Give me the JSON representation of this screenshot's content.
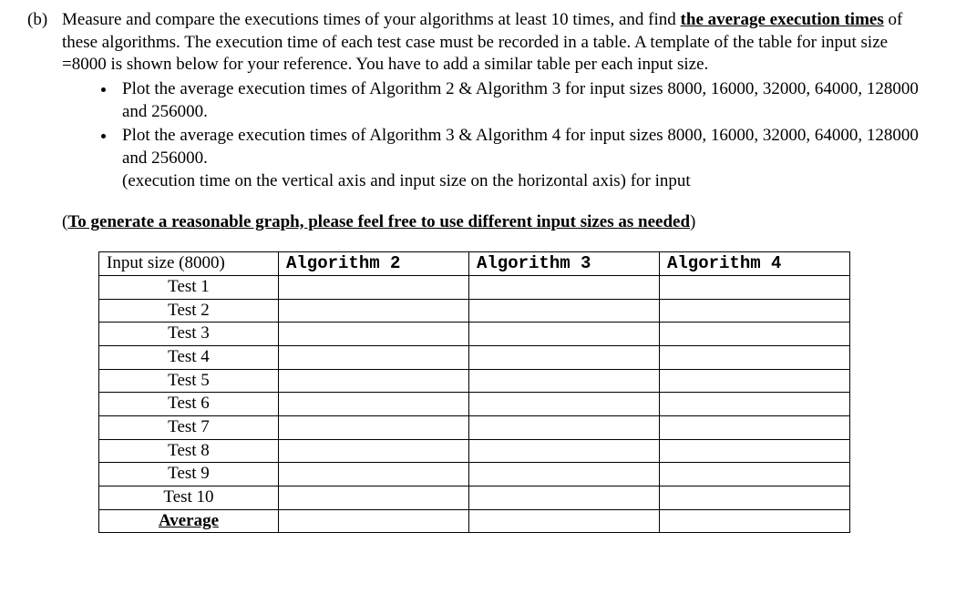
{
  "question": {
    "label": "(b)",
    "intro_1": "Measure and compare the executions times of your algorithms at least 10 times, and find ",
    "intro_underlined": "the average execution times",
    "intro_2": " of these algorithms. The execution time of each test case must be recorded in a table. A template of the table for input size =8000 is shown below for your reference. You have to add a similar table per each input size.",
    "bullets": [
      "Plot the average execution times of Algorithm 2 & Algorithm 3 for input sizes 8000, 16000, 32000, 64000, 128000 and 256000.",
      "Plot the average execution times of Algorithm 3 & Algorithm 4 for input sizes 8000, 16000, 32000, 64000, 128000 and 256000.\n(execution time on the vertical axis and input size on the horizontal axis) for input"
    ],
    "note_open": "(",
    "note_underlined": "To generate a reasonable graph, please feel free to use different input sizes as needed",
    "note_close": ")"
  },
  "table": {
    "header": {
      "col1": "Input size (8000)",
      "col2": "Algorithm 2",
      "col3": "Algorithm 3",
      "col4": "Algorithm 4"
    },
    "rows": [
      {
        "label": "Test 1",
        "a2": "",
        "a3": "",
        "a4": ""
      },
      {
        "label": "Test 2",
        "a2": "",
        "a3": "",
        "a4": ""
      },
      {
        "label": "Test 3",
        "a2": "",
        "a3": "",
        "a4": ""
      },
      {
        "label": "Test 4",
        "a2": "",
        "a3": "",
        "a4": ""
      },
      {
        "label": "Test 5",
        "a2": "",
        "a3": "",
        "a4": ""
      },
      {
        "label": "Test 6",
        "a2": "",
        "a3": "",
        "a4": ""
      },
      {
        "label": "Test 7",
        "a2": "",
        "a3": "",
        "a4": ""
      },
      {
        "label": "Test 8",
        "a2": "",
        "a3": "",
        "a4": ""
      },
      {
        "label": "Test 9",
        "a2": "",
        "a3": "",
        "a4": ""
      },
      {
        "label": "Test 10",
        "a2": "",
        "a3": "",
        "a4": ""
      }
    ],
    "average_label": "Average"
  }
}
